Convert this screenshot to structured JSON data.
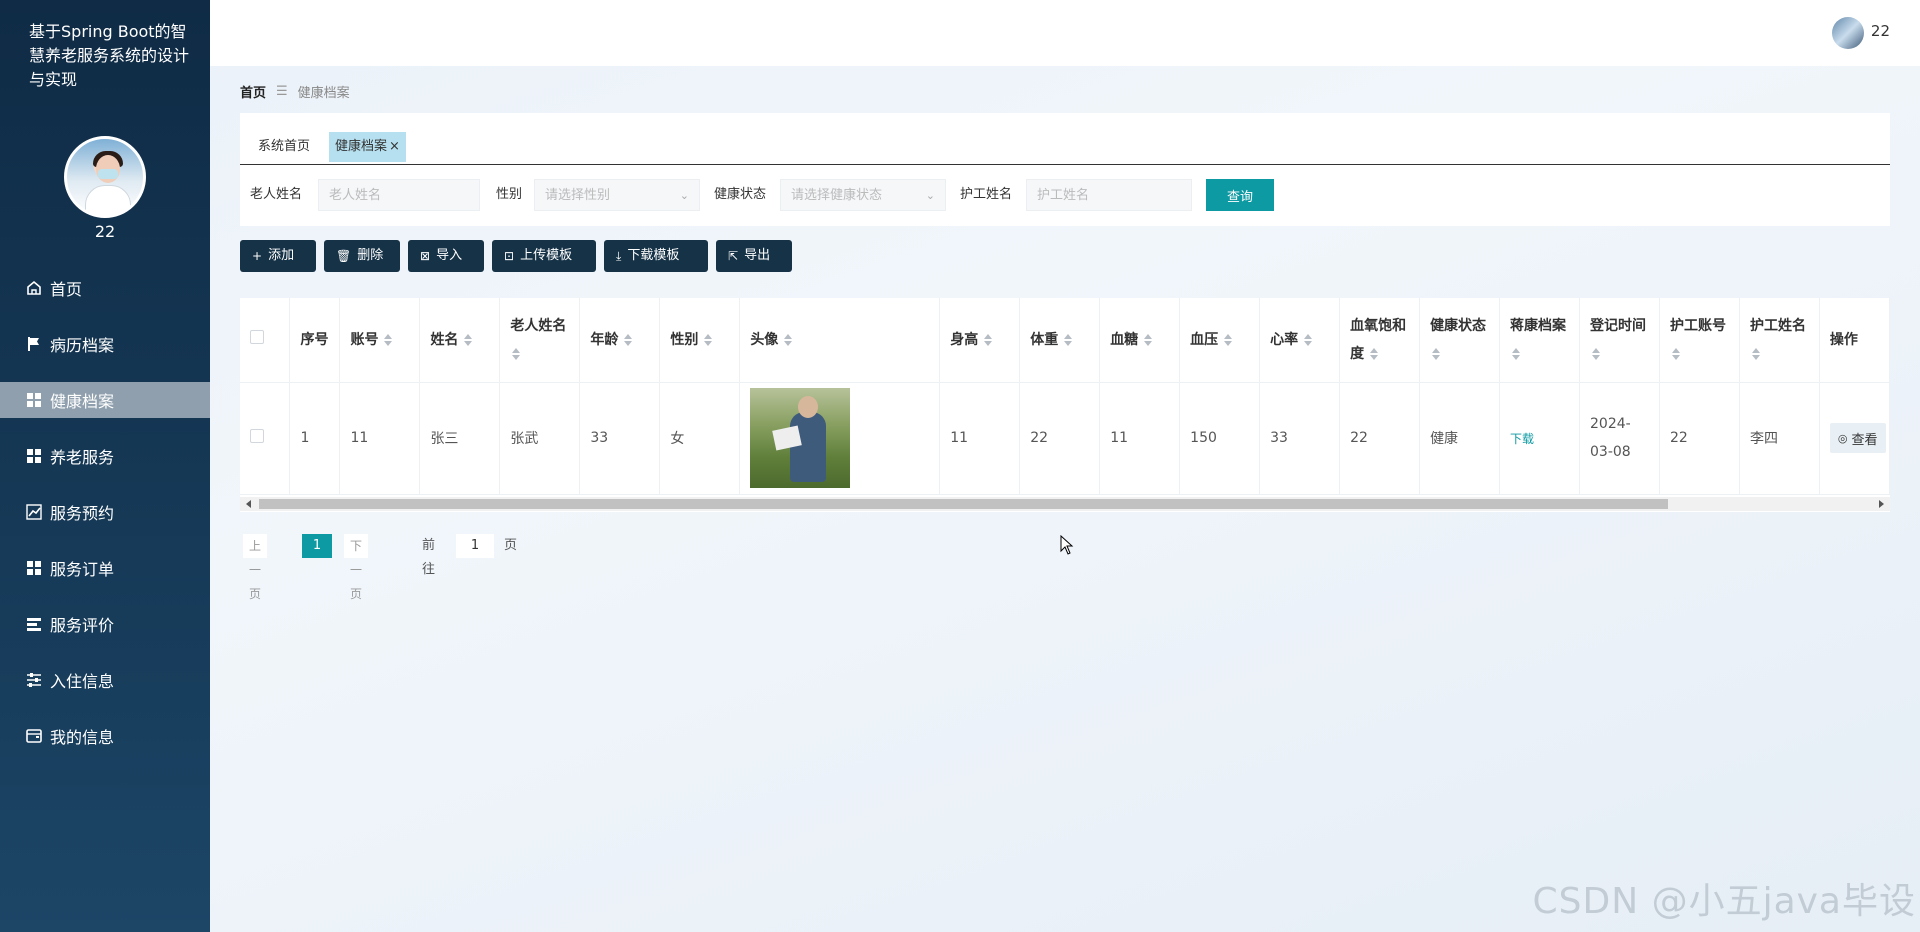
{
  "app": {
    "title": "基于Spring Boot的智慧养老服务系统的设计与实现"
  },
  "user": {
    "name": "22"
  },
  "menu": {
    "items": [
      {
        "label": "首页",
        "icon": "home-icon"
      },
      {
        "label": "病历档案",
        "icon": "flag-icon"
      },
      {
        "label": "健康档案",
        "icon": "grid-icon",
        "active": true
      },
      {
        "label": "养老服务",
        "icon": "grid-icon"
      },
      {
        "label": "服务预约",
        "icon": "chart-icon"
      },
      {
        "label": "服务订单",
        "icon": "grid-icon"
      },
      {
        "label": "服务评价",
        "icon": "list-icon"
      },
      {
        "label": "入住信息",
        "icon": "sliders-icon"
      },
      {
        "label": "我的信息",
        "icon": "wallet-icon"
      }
    ]
  },
  "breadcrumb": {
    "home": "首页",
    "separator": "☰",
    "current": "健康档案"
  },
  "tabs": [
    {
      "label": "系统首页"
    },
    {
      "label": "健康档案",
      "close": "×"
    }
  ],
  "search": {
    "elder_name_label": "老人姓名",
    "elder_name_placeholder": "老人姓名",
    "gender_label": "性别",
    "gender_placeholder": "请选择性别",
    "health_label": "健康状态",
    "health_placeholder": "请选择健康状态",
    "nurse_label": "护工姓名",
    "nurse_placeholder": "护工姓名",
    "query_button": "查询"
  },
  "actions": [
    {
      "label": "添加",
      "icon": "+"
    },
    {
      "label": "删除",
      "icon": "🗑"
    },
    {
      "label": "导入",
      "icon": "⊠"
    },
    {
      "label": "上传模板",
      "icon": "⊡"
    },
    {
      "label": "下载模板",
      "icon": "⤓"
    },
    {
      "label": "导出",
      "icon": "⇱"
    }
  ],
  "table": {
    "headers": {
      "index": "序号",
      "account": "账号",
      "name": "姓名",
      "elder_name": "老人姓名",
      "age": "年龄",
      "gender": "性别",
      "avatar": "头像",
      "height": "身高",
      "weight": "体重",
      "blood_sugar": "血糖",
      "blood_pressure": "血压",
      "heart_rate": "心率",
      "spo2": "血氧饱和度",
      "health_status": "健康状态",
      "health_file": "蒋康档案",
      "register_time": "登记时间",
      "nurse_account": "护工账号",
      "nurse_name": "护工姓名",
      "operation": "操作"
    },
    "rows": [
      {
        "index": "1",
        "account": "11",
        "name": "张三",
        "elder_name": "张武",
        "age": "33",
        "gender": "女",
        "height": "11",
        "weight": "22",
        "blood_sugar": "11",
        "blood_pressure": "150",
        "heart_rate": "33",
        "spo2": "22",
        "health_status": "健康",
        "health_file": "下载",
        "register_time": "2024-03-08",
        "nurse_account": "22",
        "nurse_name": "李四",
        "operation": "查看"
      }
    ]
  },
  "pagination": {
    "prev": "上一页",
    "current": "1",
    "next": "下一页",
    "goto_label": "前往",
    "goto_value": "1",
    "page_suffix": "页"
  },
  "watermark": "CSDN @小五java毕设",
  "colors": {
    "sidebar": "#163a58",
    "accent": "#0d9aa3",
    "button_dark": "#163247",
    "active_menu": "#8f9fad"
  }
}
